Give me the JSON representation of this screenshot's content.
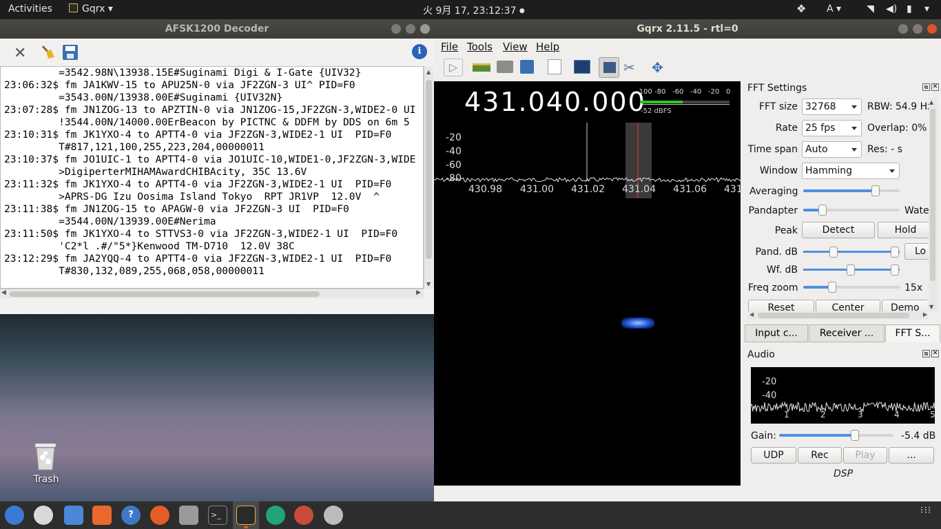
{
  "topbar": {
    "activities": "Activities",
    "app_menu": "Gqrx",
    "clock": "火 9月 17, 23:12:37",
    "input_method": "A"
  },
  "afsk": {
    "title": "AFSK1200 Decoder",
    "log": [
      "         =3542.98N\\13938.15E#Suginami Digi & I-Gate {UIV32}",
      "23:06:32$ fm JA1KWV-15 to APU25N-0 via JF2ZGN-3 UI^ PID=F0",
      "         =3543.00N/13938.00E#Suginami {UIV32N}",
      "23:07:28$ fm JN1ZOG-13 to APZTIN-0 via JN1ZOG-15,JF2ZGN-3,WIDE2-0 UI",
      "         !3544.00N/14000.00ErBeacon by PICTNC & DDFM by DDS on 6m 5",
      "23:10:31$ fm JK1YXO-4 to APTT4-0 via JF2ZGN-3,WIDE2-1 UI  PID=F0",
      "         T#817,121,100,255,223,204,00000011",
      "23:10:37$ fm JO1UIC-1 to APTT4-0 via JO1UIC-10,WIDE1-0,JF2ZGN-3,WIDE",
      "         >DigiperterMIHAMAwardCHIBAcity, 35C 13.6V",
      "23:11:32$ fm JK1YXO-4 to APTT4-0 via JF2ZGN-3,WIDE2-1 UI  PID=F0",
      "         >APRS-DG Izu Oosima Island Tokyo  RPT JR1VP  12.0V  ^",
      "23:11:38$ fm JN1ZOG-15 to APAGW-0 via JF2ZGN-3 UI  PID=F0",
      "         =3544.00N/13939.00E#Nerima",
      "23:11:50$ fm JK1YXO-4 to STTVS3-0 via JF2ZGN-3,WIDE2-1 UI  PID=F0",
      "         'C2*l .#/\"5*}Kenwood TM-D710  12.0V 38C",
      "23:12:29$ fm JA2YQQ-4 to APTT4-0 via JF2ZGN-3,WIDE2-1 UI  PID=F0",
      "         T#830,132,089,255,068,058,00000011"
    ]
  },
  "desktop": {
    "trash_label": "Trash"
  },
  "gqrx": {
    "title": "Gqrx 2.11.5 - rtl=0",
    "menu": {
      "file": "File",
      "tools": "Tools",
      "view": "View",
      "help": "Help"
    },
    "frequency": "431.040.000",
    "meter": {
      "ticks": [
        "-100",
        "-80",
        "-60",
        "-40",
        "-20",
        "0"
      ],
      "readout": "-52 dBFS",
      "level": 0.48
    },
    "fft_plot": {
      "db_labels": [
        "-20",
        "-40",
        "-60",
        "-80"
      ],
      "freq_labels": [
        "430.98",
        "431.00",
        "431.02",
        "431.04",
        "431.06",
        "431"
      ]
    },
    "fft_settings": {
      "header": "FFT Settings",
      "fft_size_label": "FFT size",
      "fft_size": "32768",
      "rbw": "RBW: 54.9 Hz",
      "rate_label": "Rate",
      "rate": "25 fps",
      "overlap": "Overlap: 0%",
      "timespan_label": "Time span",
      "timespan": "Auto",
      "res": "Res: - s",
      "window_label": "Window",
      "window": "Hamming",
      "averaging_label": "Averaging",
      "averaging": 0.75,
      "pandapter_label": "Pandapter",
      "waterfall_label": "Wate",
      "pandapter": 0.2,
      "peak_label": "Peak",
      "detect": "Detect",
      "hold": "Hold",
      "pand_db_label": "Pand. dB",
      "lock_btn": "Lo",
      "wf_db_label": "Wf. dB",
      "freq_zoom_label": "Freq zoom",
      "freq_zoom": "15x",
      "freq_zoom_level": 0.3,
      "reset": "Reset",
      "center": "Center",
      "demod": "Demo"
    },
    "tabs": [
      "Input c...",
      "Receiver ...",
      "FFT S..."
    ],
    "audio": {
      "header": "Audio",
      "db_labels": [
        "-20",
        "-40"
      ],
      "freq_labels": [
        "1",
        "2",
        "3",
        "4",
        "5"
      ],
      "gain_label": "Gain:",
      "gain": "-5.4 dB",
      "gain_level": 0.66,
      "udp": "UDP",
      "rec": "Rec",
      "play": "Play",
      "more": "...",
      "dsp": "DSP"
    }
  }
}
